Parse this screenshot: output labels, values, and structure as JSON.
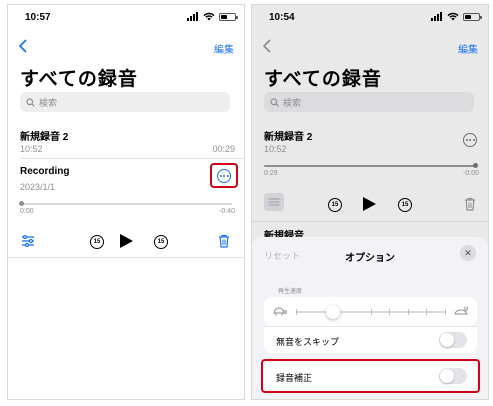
{
  "left": {
    "status_time": "10:57",
    "nav": {
      "edit_label": "編集"
    },
    "title": "すべての録音",
    "search": {
      "placeholder": "検索"
    },
    "recordings": [
      {
        "title": "新規録音 2",
        "date": "10:52",
        "duration": "00:29"
      },
      {
        "title": "Recording",
        "date": "2023/1/1"
      }
    ],
    "player": {
      "elapsed": "0:00",
      "remaining": "-0:40",
      "progress": 0.0,
      "skip_back": "15",
      "skip_forward": "15"
    }
  },
  "right": {
    "status_time": "10:54",
    "nav": {
      "edit_label": "編集"
    },
    "title": "すべての録音",
    "search": {
      "placeholder": "検索"
    },
    "recording": {
      "title": "新規録音 2",
      "date": "10:52"
    },
    "player": {
      "elapsed": "0:29",
      "remaining": "-0:00",
      "progress": 1.0,
      "skip_back": "15",
      "skip_forward": "15"
    },
    "next_recording_title": "新規録音",
    "options_sheet": {
      "reset_label": "リセット",
      "title": "オプション",
      "speed_label": "再生速度",
      "speed_level": 0.25,
      "skip_silence_label": "無音をスキップ",
      "skip_silence_on": false,
      "enhance_label": "録音補正",
      "enhance_on": false
    }
  },
  "colors": {
    "accent": "#1a73e8",
    "highlight": "#d0021b"
  },
  "icons": [
    "chevron-left-icon",
    "search-icon",
    "more-icon",
    "equalizer-icon",
    "skip-back-icon",
    "play-icon",
    "skip-forward-icon",
    "trash-icon",
    "close-icon",
    "turtle-icon",
    "hare-icon"
  ]
}
